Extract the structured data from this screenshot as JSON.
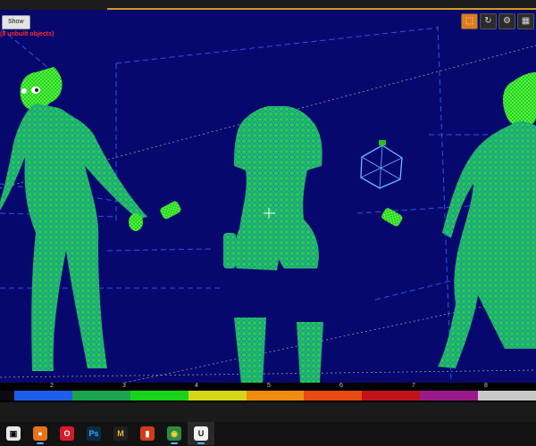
{
  "viewport": {
    "show_label": "Show",
    "unbuilt_text": "(8 unbuilt objects)",
    "toolbar": [
      {
        "icon": "perspective-icon",
        "glyph": "⬚"
      },
      {
        "icon": "rotate-icon",
        "glyph": "↻"
      },
      {
        "icon": "snap-icon",
        "glyph": "⚙"
      },
      {
        "icon": "grid-icon",
        "glyph": "▦"
      }
    ],
    "wire_color": "#1fd01f",
    "wire_accent": "#1f6fd8",
    "background": "#07086e"
  },
  "complexity_bar": {
    "tick_labels": [
      "2",
      "3",
      "4",
      "5",
      "6",
      "7",
      "8"
    ],
    "bands": [
      "#1e5de8",
      "#18a54e",
      "#18d418",
      "#d6d619",
      "#f08c10",
      "#e84a10",
      "#c4121a",
      "#9a1a8c",
      "#c8c8c8"
    ]
  },
  "taskbar": {
    "icons": [
      {
        "name": "windows-start-icon",
        "glyph": "▣",
        "color": "#e8e8e8",
        "text": "#000"
      },
      {
        "name": "firefox-icon",
        "glyph": "●",
        "color": "#e8731c",
        "text": "#fff"
      },
      {
        "name": "opera-icon",
        "glyph": "O",
        "color": "#d8192c",
        "text": "#fff"
      },
      {
        "name": "photoshop-icon",
        "glyph": "Ps",
        "color": "#0b2a44",
        "text": "#3aa6ff"
      },
      {
        "name": "marmoset-icon",
        "glyph": "M",
        "color": "#202020",
        "text": "#e8b33a"
      },
      {
        "name": "office-icon",
        "glyph": "▮",
        "color": "#d23b1a",
        "text": "#fff"
      },
      {
        "name": "chrome-icon",
        "glyph": "◉",
        "color": "#2d8a3f",
        "text": "#f5d23a"
      },
      {
        "name": "unreal-engine-icon",
        "glyph": "U",
        "color": "#f2f2f2",
        "text": "#111"
      }
    ]
  }
}
